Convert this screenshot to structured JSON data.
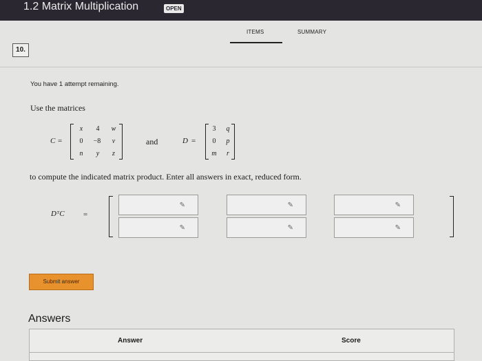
{
  "header": {
    "title": "1.2 Matrix Multiplication",
    "badge": "OPEN"
  },
  "tabs": [
    {
      "label": "ITEMS",
      "active": true
    },
    {
      "label": "SUMMARY",
      "active": false
    }
  ],
  "question": {
    "number": "10.",
    "attempts_text": "You have 1 attempt remaining.",
    "intro": "Use the matrices",
    "matrix_c": {
      "label": "C",
      "rows": [
        [
          "x",
          "4",
          "w"
        ],
        [
          "0",
          "−8",
          "v"
        ],
        [
          "n",
          "y",
          "z"
        ]
      ]
    },
    "joiner": "and",
    "matrix_d": {
      "label": "D",
      "rows": [
        [
          "3",
          "q"
        ],
        [
          "0",
          "p"
        ],
        [
          "m",
          "r"
        ]
      ]
    },
    "instruction": "to compute the indicated matrix product. Enter all answers in exact, reduced form.",
    "product_label": "DᵀC",
    "equals": "=",
    "answer_grid": {
      "rows": 2,
      "cols": 3,
      "values": [
        [
          "",
          "",
          ""
        ],
        [
          "",
          "",
          ""
        ]
      ],
      "pen_icon": "pencil-icon"
    }
  },
  "submit": {
    "label": "Submit answer",
    "color": "#e8922e"
  },
  "answers": {
    "title": "Answers",
    "columns": [
      "Answer",
      "Score"
    ]
  }
}
